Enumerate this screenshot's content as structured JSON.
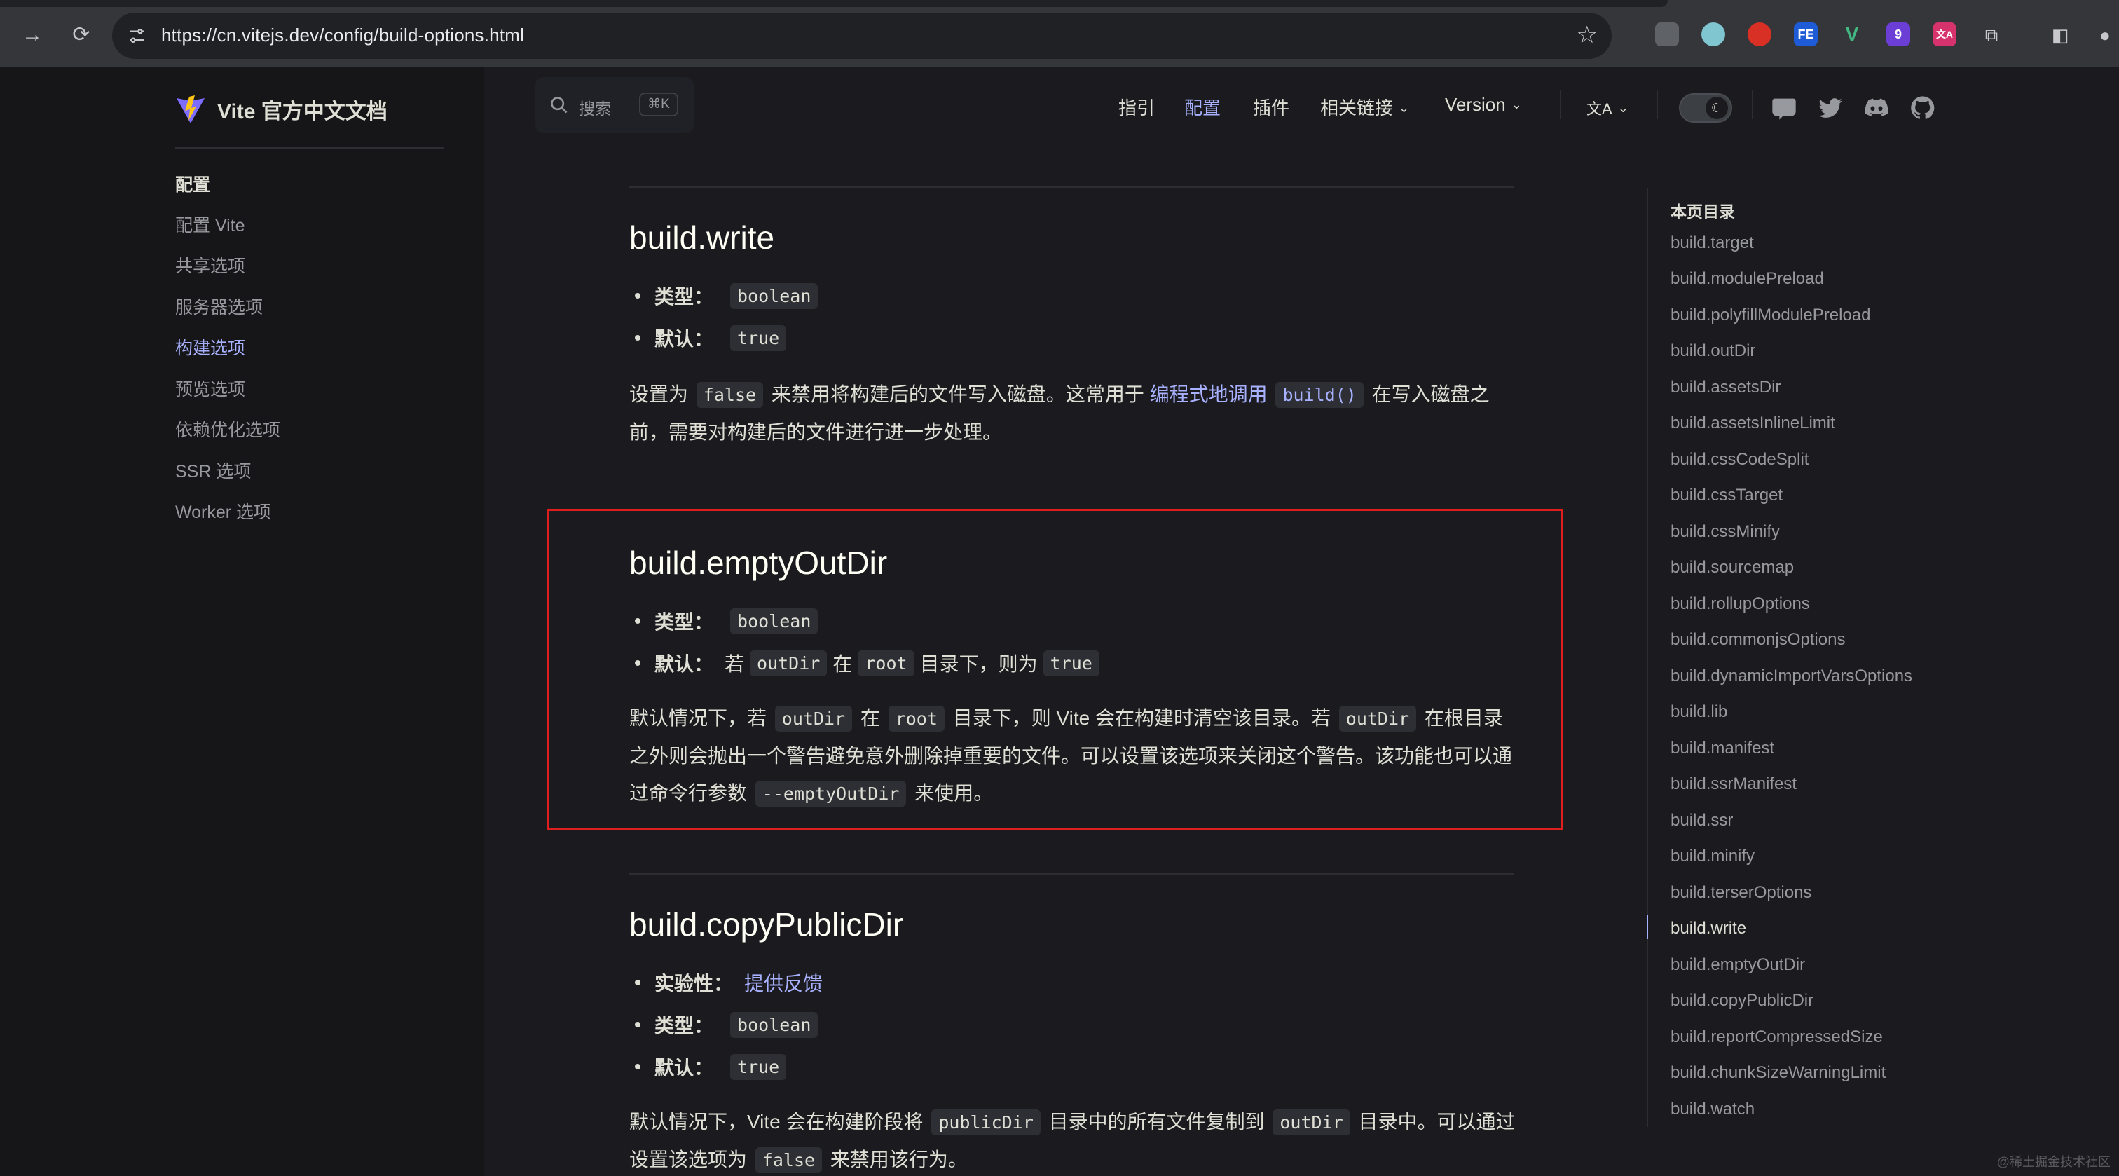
{
  "browser": {
    "url": "https://cn.vitejs.dev/config/build-options.html",
    "extensions": [
      {
        "icon": "reader-icon",
        "color": "#5f6368",
        "label": ""
      },
      {
        "icon": "circle-ext-icon",
        "color": "#7fc6d1",
        "label": ""
      },
      {
        "icon": "red-ext-icon",
        "color": "#d93025",
        "label": ""
      },
      {
        "icon": "fe-ext-icon",
        "color": "#1e5bd6",
        "label": "FE"
      },
      {
        "icon": "vue-devtools-icon",
        "color": "#42b883",
        "label": "V"
      },
      {
        "icon": "hex-ext-icon",
        "color": "#6b3fd6",
        "label": "9"
      },
      {
        "icon": "translate-ext-icon",
        "color": "#d6336c",
        "label": "文A"
      }
    ]
  },
  "sidebar": {
    "site_title": "Vite 官方中文文档",
    "section": "配置",
    "items": [
      {
        "label": "配置 Vite",
        "active": false
      },
      {
        "label": "共享选项",
        "active": false
      },
      {
        "label": "服务器选项",
        "active": false
      },
      {
        "label": "构建选项",
        "active": true
      },
      {
        "label": "预览选项",
        "active": false
      },
      {
        "label": "依赖优化选项",
        "active": false
      },
      {
        "label": "SSR 选项",
        "active": false
      },
      {
        "label": "Worker 选项",
        "active": false
      }
    ]
  },
  "search": {
    "label": "搜索",
    "shortcut": "⌘K"
  },
  "nav": {
    "guide": "指引",
    "config": "配置",
    "plugins": "插件",
    "links": "相关链接",
    "version": "Version",
    "lang": "文A"
  },
  "content": {
    "write": {
      "title": "build.write",
      "type_label": "类型：",
      "type_value": "boolean",
      "default_label": "默认：",
      "default_value": "true",
      "p1": "设置为",
      "p_code1": "false",
      "p2": "来禁用将构建后的文件写入磁盘。这常用于",
      "p_link": "编程式地调用",
      "p_code2": "build()",
      "p3": "在写入磁盘之前，需要对构建后的文件进行进一步处理。"
    },
    "emptyOutDir": {
      "title": "build.emptyOutDir",
      "type_label": "类型：",
      "type_value": "boolean",
      "default_label": "默认：",
      "d1": "若",
      "d_code1": "outDir",
      "d2": "在",
      "d_code2": "root",
      "d3": "目录下，则为",
      "d_code3": "true",
      "p1": "默认情况下，若",
      "p_code1": "outDir",
      "p2": "在",
      "p_code2": "root",
      "p3": "目录下，则 Vite 会在构建时清空该目录。若",
      "p_code3": "outDir",
      "p4": "在根目录之外则会抛出一个警告避免意外删除掉重要的文件。可以设置该选项来关闭这个警告。该功能也可以通过命令行参数",
      "p_code4": "--emptyOutDir",
      "p5": "来使用。"
    },
    "copyPublicDir": {
      "title": "build.copyPublicDir",
      "exp_label": "实验性：",
      "exp_link": "提供反馈",
      "type_label": "类型：",
      "type_value": "boolean",
      "default_label": "默认：",
      "default_value": "true",
      "p1": "默认情况下，Vite 会在构建阶段将",
      "p_code1": "publicDir",
      "p2": "目录中的所有文件复制到",
      "p_code2": "outDir",
      "p3": "目录中。可以通过设置该选项为",
      "p_code3": "false",
      "p4": "来禁用该行为。"
    }
  },
  "toc": {
    "title": "本页目录",
    "items": [
      "build.target",
      "build.modulePreload",
      "build.polyfillModulePreload",
      "build.outDir",
      "build.assetsDir",
      "build.assetsInlineLimit",
      "build.cssCodeSplit",
      "build.cssTarget",
      "build.cssMinify",
      "build.sourcemap",
      "build.rollupOptions",
      "build.commonjsOptions",
      "build.dynamicImportVarsOptions",
      "build.lib",
      "build.manifest",
      "build.ssrManifest",
      "build.ssr",
      "build.minify",
      "build.terserOptions",
      "build.write",
      "build.emptyOutDir",
      "build.copyPublicDir",
      "build.reportCompressedSize",
      "build.chunkSizeWarningLimit",
      "build.watch"
    ],
    "active_index": 19
  },
  "watermark": "@稀土掘金技术社区",
  "colors": {
    "accent": "#a8b1ff",
    "highlight_box": "#e01e1e",
    "background": "#1b1b1f"
  }
}
